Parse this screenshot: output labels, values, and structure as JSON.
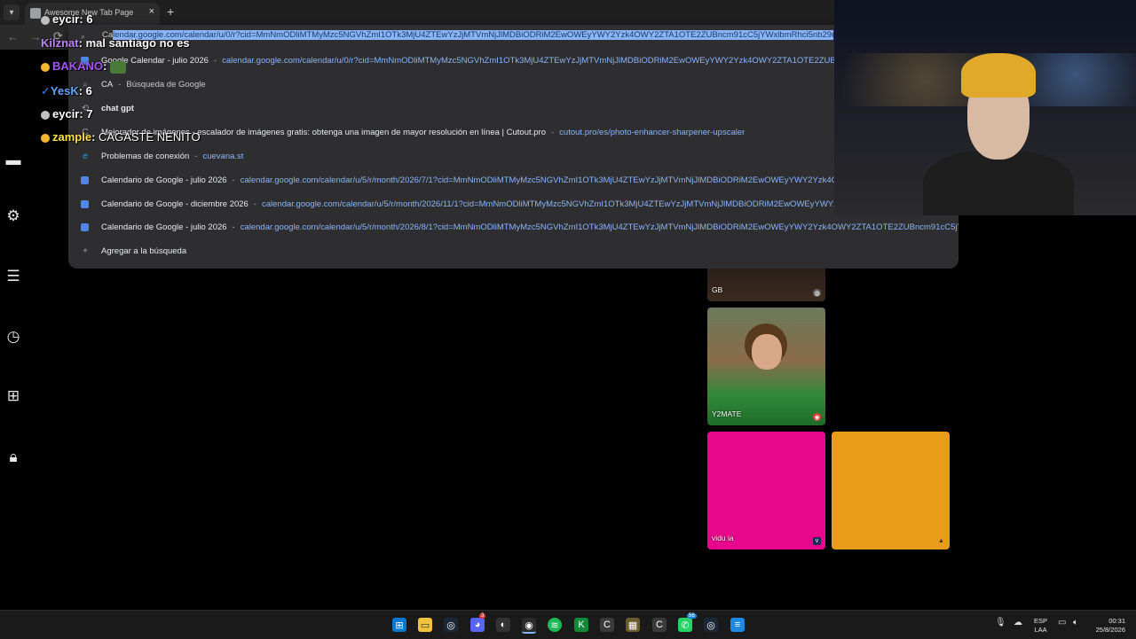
{
  "browser": {
    "tab_title": "Awesome New Tab Page",
    "tab_close": "×",
    "new_tab": "+",
    "nav": {
      "back": "←",
      "forward": "→",
      "reload": "⟳"
    },
    "address_prefix": "Ca",
    "address_selected": "lendar.google.com/calendar/u/0/r?cid=MmNmODliMTMyMzc5NGVhZmI1OTk3MjU4ZTEwYzJjMTVmNjJlMDBiODRiM2EwOWEyYWY2Yzk4OWY2ZTA1OTE2ZUBncm91cC5jYWxlbmRhci5nb29nbGUuY29"
  },
  "suggestions": [
    {
      "title": "Google Calendar - julio 2026",
      "url": "calendar.google.com/calendar/u/0/r?cid=MmNmODliMTMyMzc5NGVhZmI1OTk3MjU4ZTEwYzJjMTVmNjJlMDBiODRiM2EwOWEyYWY2Yzk4OWY2ZTA1OTE2ZUBncm91cC5jYWxlbmRhci5nb29nbGUuY29",
      "icon": "calendar-icon"
    },
    {
      "title": "CA",
      "sub": "Búsqueda de Google",
      "icon": "search-icon"
    },
    {
      "title": "chat gpt",
      "icon": "history-icon"
    },
    {
      "title": "Mejorador de imágenes - escalador de imágenes gratis: obtenga una imagen de mayor resolución en línea | Cutout.pro",
      "url": "cutout.pro/es/photo-enhancer-sharpener-upscaler",
      "icon": "page-icon"
    },
    {
      "title": "Problemas de conexión",
      "url": "cuevana.st",
      "icon": "edge-icon"
    },
    {
      "title": "Calendario de Google - julio 2026",
      "url": "calendar.google.com/calendar/u/5/r/month/2026/7/1?cid=MmNmODliMTMyMzc5NGVhZmI1OTk3MjU4ZTEwYzJjMTVmNjJlMDBiODRiM2EwOWEyYWY2Yzk4OWY2ZTA1OTE2ZUBncm91cC5jYWxlbmRhci5nb29nbGUuY29",
      "icon": "calendar-icon"
    },
    {
      "title": "Calendario de Google - diciembre 2026",
      "url": "calendar.google.com/calendar/u/5/r/month/2026/11/1?cid=MmNmODliMTMyMzc5NGVhZmI1OTk3MjU4ZTEwYzJjMTVmNjJlMDBiODRiM2EwOWEyYWY2Yzk4OWY2ZTA1OTE2ZUBncm91cC5jYWxlbmRhci5nb29nbGUuY29",
      "icon": "calendar-icon"
    },
    {
      "title": "Calendario de Google - julio 2026",
      "url": "calendar.google.com/calendar/u/5/r/month/2026/8/1?cid=MmNmODliMTMyMzc5NGVhZmI1OTk3MjU4ZTEwYzJjMTVmNjJlMDBiODRiM2EwOWEyYWY2Yzk4OWY2ZTA1OTE2ZUBncm91cC5jYWxlbmRhci5nb29nbGUuY29tbc91...",
      "icon": "calendar-icon"
    }
  ],
  "add_to_search": {
    "icon": "+",
    "label": "Agregar a la búsqueda"
  },
  "chat": [
    {
      "user": "eycir",
      "sep": ": ",
      "msg": "6",
      "color": "#ffffff",
      "badge": "#c0c0c0"
    },
    {
      "user": "Kilznat",
      "sep": ": ",
      "msg": "mal santiago no es",
      "color": "#c084fc",
      "badge": ""
    },
    {
      "user": "BAKANO",
      "sep": ": ",
      "msg": "",
      "color": "#a855f7",
      "badge": "#f7b731"
    },
    {
      "user": "YesK",
      "sep": ": ",
      "msg": "6",
      "color": "#60a5fa",
      "badge": "#3b82f6"
    },
    {
      "user": "eycir",
      "sep": ": ",
      "msg": "7",
      "color": "#ffffff",
      "badge": "#c0c0c0"
    },
    {
      "user": "zample",
      "sep": ": ",
      "msg": "CAGASTE NENITO",
      "color": "#fde047",
      "badge": "#f7b731"
    }
  ],
  "tiles": [
    {
      "label": "GB",
      "color": "#3b2a1f"
    },
    {
      "label": "Y2MATE",
      "color": "#4a7a3a"
    },
    {
      "label": "vidu ia",
      "color": "#e8078c"
    },
    {
      "label": "",
      "color": "#e89c1a"
    }
  ],
  "taskbar": {
    "language": "ESP",
    "layout": "LAA",
    "time": "00:31",
    "date": "25/8/2026",
    "badges": {
      "discord": "3",
      "whatsapp": "56"
    }
  },
  "colors": {
    "accent": "#8ab4f8",
    "dropdown_bg": "#2e2e30",
    "selection": "#8ab4f8"
  }
}
